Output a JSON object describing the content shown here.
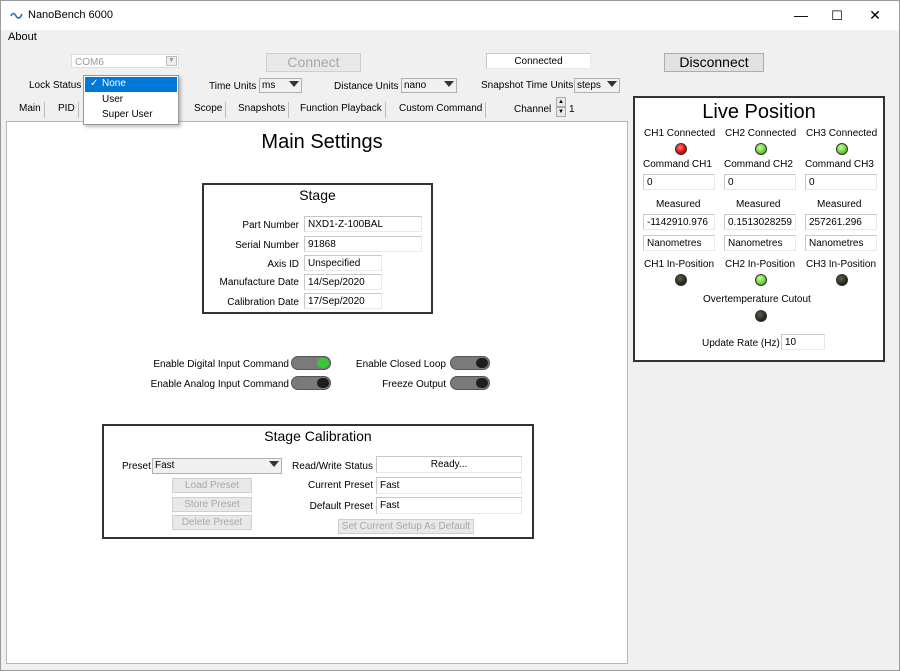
{
  "window": {
    "title": "NanoBench 6000",
    "minimize": "—",
    "maximize": "☐",
    "close": "✕"
  },
  "menu": {
    "about": "About"
  },
  "connection": {
    "port": "COM6",
    "connect_label": "Connect",
    "status": "Connected",
    "disconnect_label": "Disconnect"
  },
  "settings_row": {
    "lock_status_label": "Lock Status",
    "lock_options": [
      "None",
      "User",
      "Super User"
    ],
    "lock_selected_check": "✓",
    "time_units_label": "Time Units",
    "time_units_value": "ms",
    "distance_units_label": "Distance Units",
    "distance_units_value": "nano",
    "snapshot_units_label": "Snapshot Time Units",
    "snapshot_units_value": "steps"
  },
  "tabs": [
    "Main",
    "PID",
    "Scope",
    "Snapshots",
    "Function Playback",
    "Custom Command"
  ],
  "channel": {
    "label": "Channel",
    "value": "1"
  },
  "main": {
    "title": "Main Settings",
    "stage": {
      "title": "Stage",
      "part_number_label": "Part Number",
      "part_number": "NXD1-Z-100BAL",
      "serial_number_label": "Serial Number",
      "serial_number": "91868",
      "axis_id_label": "Axis ID",
      "axis_id": "Unspecified",
      "manufacture_date_label": "Manufacture Date",
      "manufacture_date": "14/Sep/2020",
      "calibration_date_label": "Calibration Date",
      "calibration_date": "17/Sep/2020"
    },
    "toggles": {
      "digital_input": "Enable Digital Input Command",
      "analog_input": "Enable Analog Input Command",
      "closed_loop": "Enable Closed Loop",
      "freeze_output": "Freeze Output"
    },
    "calibration": {
      "title": "Stage Calibration",
      "preset_label": "Preset",
      "preset_value": "Fast",
      "load_preset": "Load Preset",
      "store_preset": "Store Preset",
      "delete_preset": "Delete Preset",
      "rw_status_label": "Read/Write Status",
      "rw_status": "Ready...",
      "current_preset_label": "Current Preset",
      "current_preset": "Fast",
      "default_preset_label": "Default Preset",
      "default_preset": "Fast",
      "set_default": "Set Current Setup As Default"
    }
  },
  "live": {
    "title": "Live Position",
    "channels": [
      {
        "connected_label": "CH1 Connected",
        "command_label": "Command CH1",
        "command": "0",
        "measured_label": "Measured",
        "measured": "-1142910.976",
        "units": "Nanometres",
        "inpos_label": "CH1 In-Position",
        "connected_color": "#e00000",
        "inpos_color": "#202015"
      },
      {
        "connected_label": "CH2 Connected",
        "command_label": "Command CH2",
        "command": "0",
        "measured_label": "Measured",
        "measured": "0.1513028259",
        "units": "Nanometres",
        "inpos_label": "CH2 In-Position",
        "connected_color": "#66cc33",
        "inpos_color": "#66cc33"
      },
      {
        "connected_label": "CH3 Connected",
        "command_label": "Command CH3",
        "command": "0",
        "measured_label": "Measured",
        "measured": "257261.296",
        "units": "Nanometres",
        "inpos_label": "CH3 In-Position",
        "connected_color": "#66cc33",
        "inpos_color": "#202015"
      }
    ],
    "overtemp_label": "Overtemperature Cutout",
    "update_rate_label": "Update Rate (Hz)",
    "update_rate": "10"
  }
}
